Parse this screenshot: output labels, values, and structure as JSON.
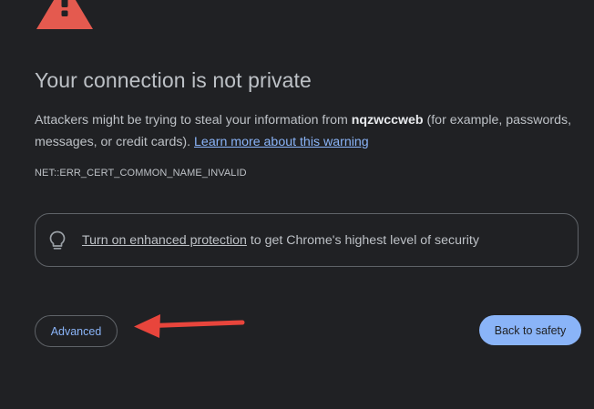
{
  "icons": {
    "warning": "warning-triangle-icon",
    "bulb": "lightbulb-icon",
    "arrow": "red-arrow-annotation"
  },
  "colors": {
    "background": "#202124",
    "text": "#bdc1c6",
    "link": "#8ab4f8",
    "warning_red": "#e45a4f",
    "arrow_red": "#e8453c",
    "button_primary_bg": "#8ab4f8"
  },
  "heading": "Your connection is not private",
  "description": {
    "prefix": "Attackers might be trying to steal your information from ",
    "host": "nqzwccweb",
    "suffix": " (for example, passwords, messages, or credit cards). ",
    "learn_more": "Learn more about this warning"
  },
  "error_code": "NET::ERR_CERT_COMMON_NAME_INVALID",
  "enhanced_protection": {
    "link_text": "Turn on enhanced protection",
    "rest_text": " to get Chrome's highest level of security"
  },
  "buttons": {
    "advanced": "Advanced",
    "back_to_safety": "Back to safety"
  }
}
